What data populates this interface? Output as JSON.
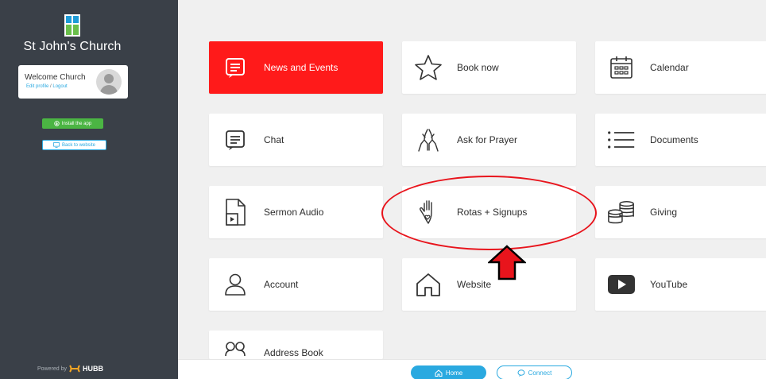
{
  "sidebar": {
    "church_name": "St John's Church",
    "welcome_title": "Welcome Church",
    "edit_profile": "Edit profile",
    "separator": "/",
    "logout": "Logout",
    "install_label": "Install the app",
    "back_label": "Back to website",
    "powered_by": "Powered by",
    "brand": "HUBB"
  },
  "tiles": [
    {
      "label": "News and Events",
      "icon": "news-icon"
    },
    {
      "label": "Book now",
      "icon": "star-icon"
    },
    {
      "label": "Calendar",
      "icon": "calendar-icon"
    },
    {
      "label": "Chat",
      "icon": "chat-icon"
    },
    {
      "label": "Ask for Prayer",
      "icon": "praying-hands-icon"
    },
    {
      "label": "Documents",
      "icon": "list-icon"
    },
    {
      "label": "Sermon Audio",
      "icon": "audio-file-icon"
    },
    {
      "label": "Rotas + Signups",
      "icon": "hand-heart-icon"
    },
    {
      "label": "Giving",
      "icon": "coins-icon"
    },
    {
      "label": "Account",
      "icon": "person-icon"
    },
    {
      "label": "Website",
      "icon": "house-icon"
    },
    {
      "label": "YouTube",
      "icon": "youtube-icon"
    },
    {
      "label": "Address Book",
      "icon": "address-book-icon"
    }
  ],
  "bottom": {
    "home_label": "Home",
    "connect_label": "Connect"
  },
  "colors": {
    "sidebar_bg": "#3a4048",
    "accent_red": "#ff1a1a",
    "accent_blue": "#2aa9e0",
    "install_green": "#4bb543",
    "annotation_red": "#e8141c"
  }
}
